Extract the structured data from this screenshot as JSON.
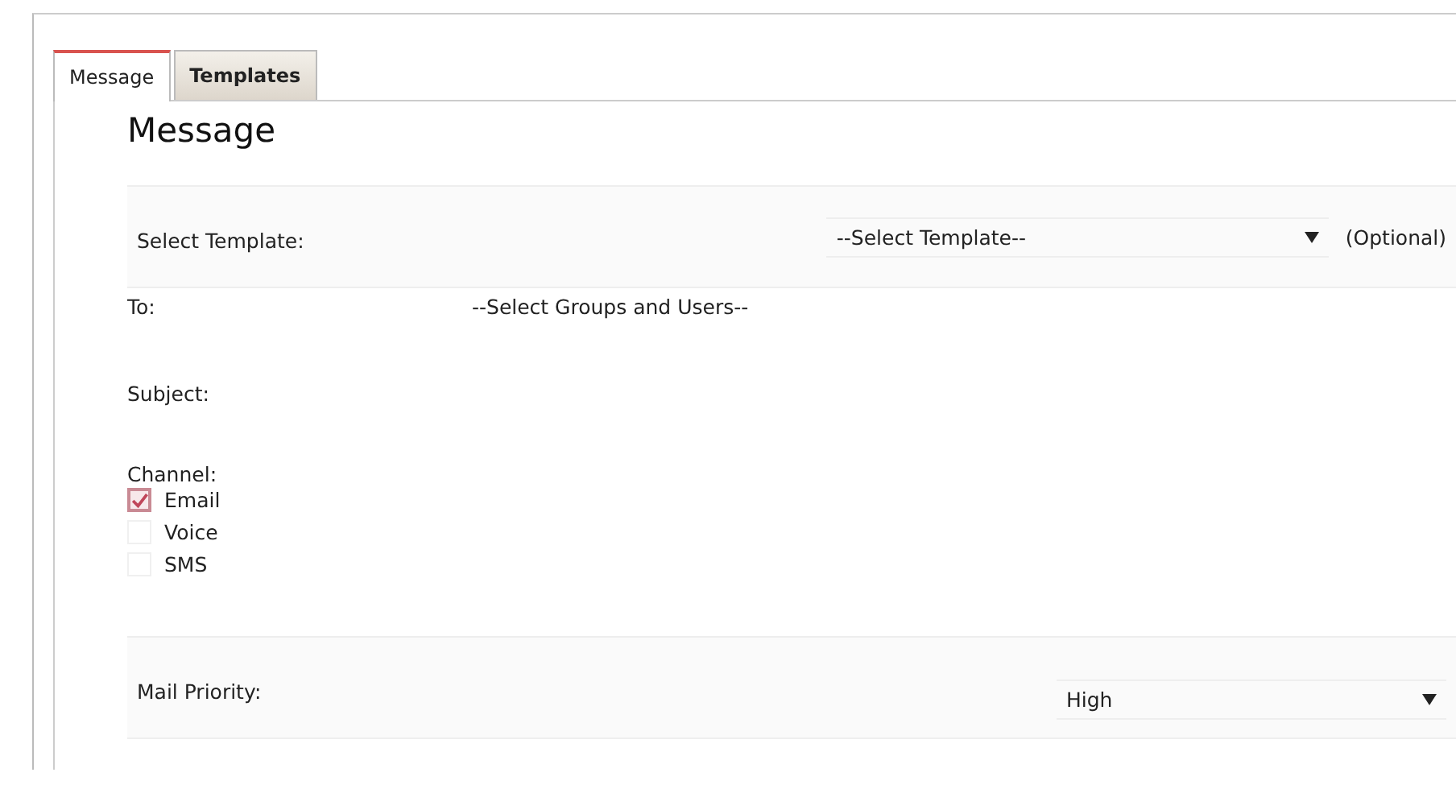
{
  "tabs": [
    {
      "label": "Message",
      "selected": true
    },
    {
      "label": "Templates",
      "selected": false
    }
  ],
  "heading": "Message",
  "fields": [
    {
      "kind": "select",
      "label": "Select Template:",
      "value": "--Select Template--",
      "note": "(Optional)"
    },
    {
      "kind": "text",
      "label": "To:",
      "value": "--Select Groups and Users--"
    },
    {
      "kind": "empty",
      "label": "Subject:"
    },
    {
      "kind": "checks",
      "label": "Channel:",
      "options": [
        {
          "label": "Email",
          "checked": true
        },
        {
          "label": "Voice",
          "checked": false
        },
        {
          "label": "SMS",
          "checked": false
        }
      ]
    },
    {
      "kind": "select",
      "label": "Mail Priority:",
      "value": "High"
    }
  ]
}
